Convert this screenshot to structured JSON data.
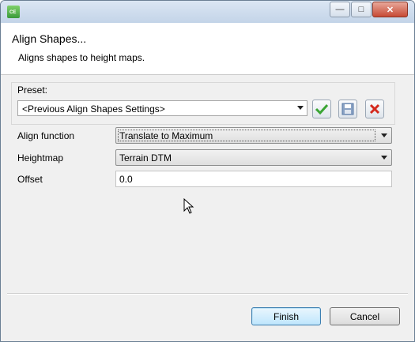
{
  "window": {
    "app_icon_text": "CE",
    "controls": {
      "minimize": "—",
      "maximize": "□",
      "close": "✕"
    }
  },
  "header": {
    "title": "Align Shapes...",
    "subtitle": "Aligns shapes to height maps."
  },
  "preset": {
    "label": "Preset:",
    "value": "<Previous Align Shapes Settings>",
    "icons": [
      "check-icon",
      "save-icon",
      "delete-icon"
    ]
  },
  "form": {
    "align_function": {
      "label": "Align function",
      "value": "Translate to Maximum"
    },
    "heightmap": {
      "label": "Heightmap",
      "value": "Terrain DTM"
    },
    "offset": {
      "label": "Offset",
      "value": "0.0"
    }
  },
  "buttons": {
    "finish": "Finish",
    "cancel": "Cancel"
  },
  "colors": {
    "check": "#3aa534",
    "delete": "#d42a1e",
    "save": "#5a7aa6"
  }
}
